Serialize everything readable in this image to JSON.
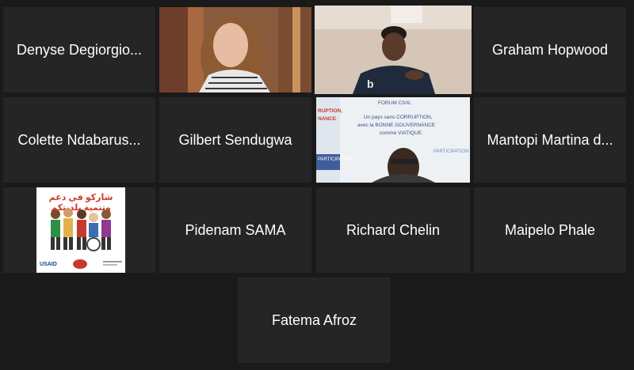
{
  "participants": [
    {
      "name": "Denyse Degiorgio..."
    },
    {
      "name": "Graham Hopwood"
    },
    {
      "name": "Colette Ndabarus..."
    },
    {
      "name": "Gilbert Sendugwa"
    },
    {
      "name": "Mantopi Martina d..."
    },
    {
      "name": "Pidenam SAMA"
    },
    {
      "name": "Richard Chelin"
    },
    {
      "name": "Maipelo Phale"
    },
    {
      "name": "Fatema Afroz"
    }
  ],
  "logo_card": {
    "title": "شاركو في دعم وتنمية بلديتكم",
    "sponsor": "USAID"
  },
  "poster": {
    "line1": "FORUM CIVIL",
    "line2": "Un pays sans CORRUPTION,",
    "line3": "avec la BONNE GOUVERNANCE",
    "line4": "comme VIATIQUE.",
    "left_word1": "RUPTION,",
    "left_word2": "NANCE",
    "left_word3": "PARTICIPATION",
    "right_word": "PARTICIPATION"
  },
  "colors": {
    "background": "#1a1a1a",
    "tile": "#252525",
    "active_speaker_border": "#d9e86a"
  }
}
